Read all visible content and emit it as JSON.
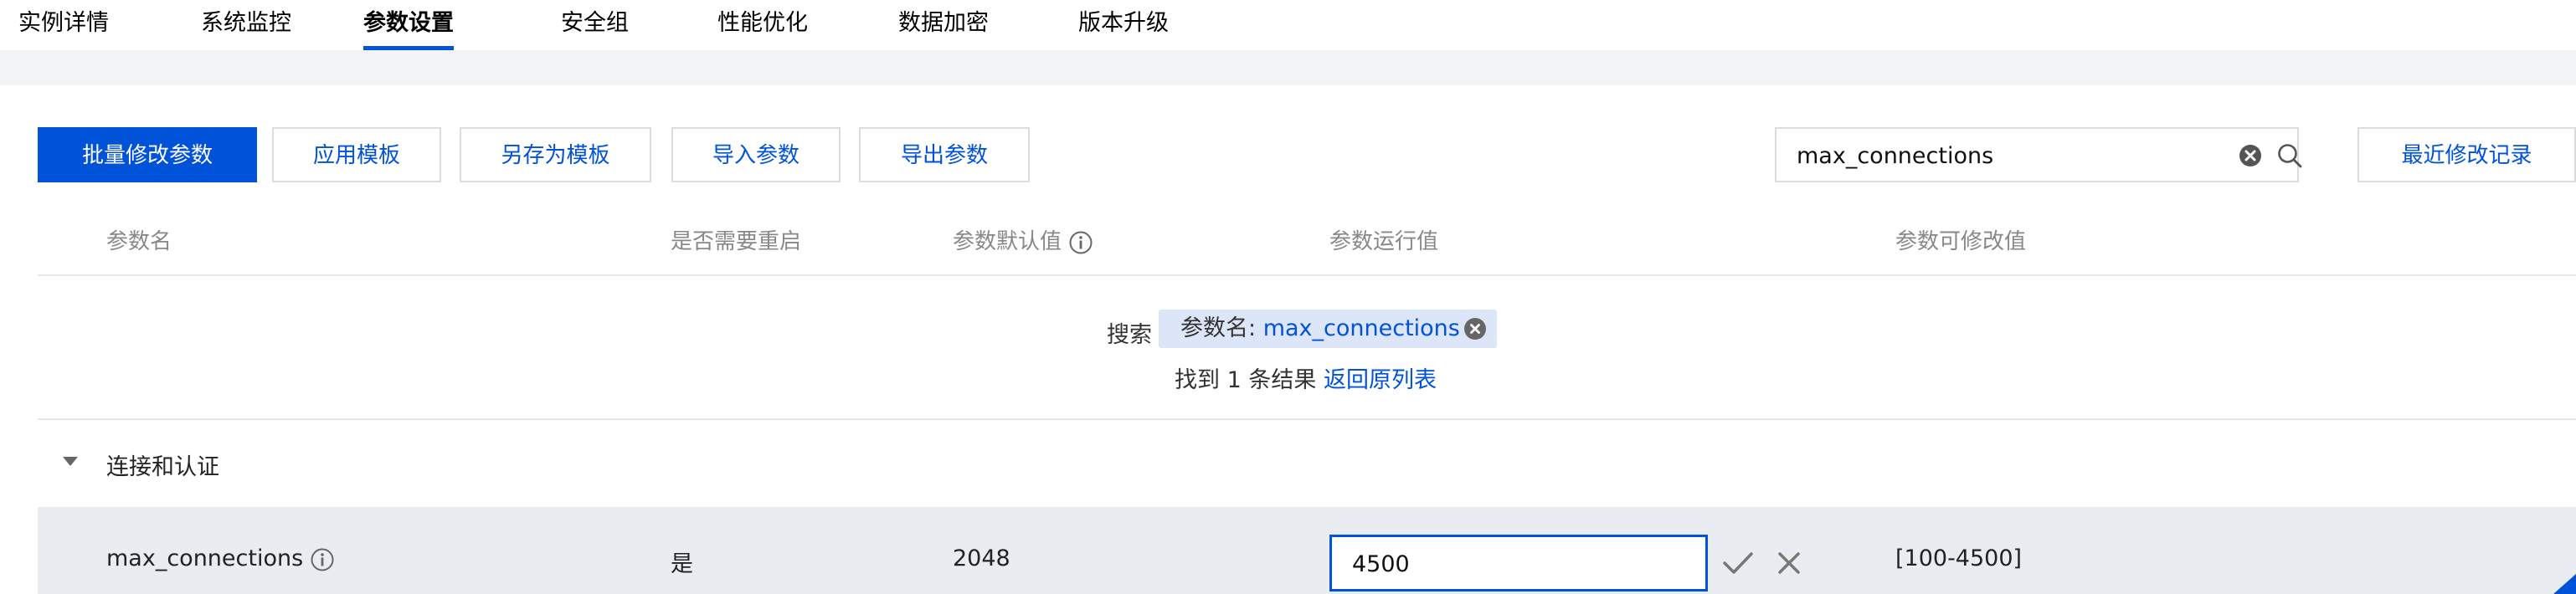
{
  "tabs": [
    {
      "label": "实例详情",
      "active": false
    },
    {
      "label": "系统监控",
      "active": false
    },
    {
      "label": "参数设置",
      "active": true
    },
    {
      "label": "安全组",
      "active": false
    },
    {
      "label": "性能优化",
      "active": false
    },
    {
      "label": "数据加密",
      "active": false
    },
    {
      "label": "版本升级",
      "active": false
    }
  ],
  "toolbar": {
    "batch_modify": "批量修改参数",
    "apply_template": "应用模板",
    "save_as_template": "另存为模板",
    "import_params": "导入参数",
    "export_params": "导出参数",
    "recent_changes": "最近修改记录"
  },
  "search": {
    "value": "max_connections",
    "clear_icon": "clear-circle-icon",
    "search_icon": "search-icon"
  },
  "table": {
    "headers": {
      "name": "参数名",
      "restart": "是否需要重启",
      "default": "参数默认值",
      "running": "参数运行值",
      "range": "参数可修改值"
    }
  },
  "filter": {
    "label": "搜索",
    "tag_key": "参数名:",
    "tag_value": "max_connections",
    "result_text": "找到 1 条结果",
    "back_link": "返回原列表"
  },
  "group": {
    "label": "连接和认证",
    "expanded": true
  },
  "rows": [
    {
      "name": "max_connections",
      "restart": "是",
      "default": "2048",
      "running": "4500",
      "range": "[100-4500]"
    }
  ],
  "colors": {
    "accent": "#0052d9",
    "row_highlight": "#e9ecf1",
    "tag_bg": "#dce6f8"
  }
}
